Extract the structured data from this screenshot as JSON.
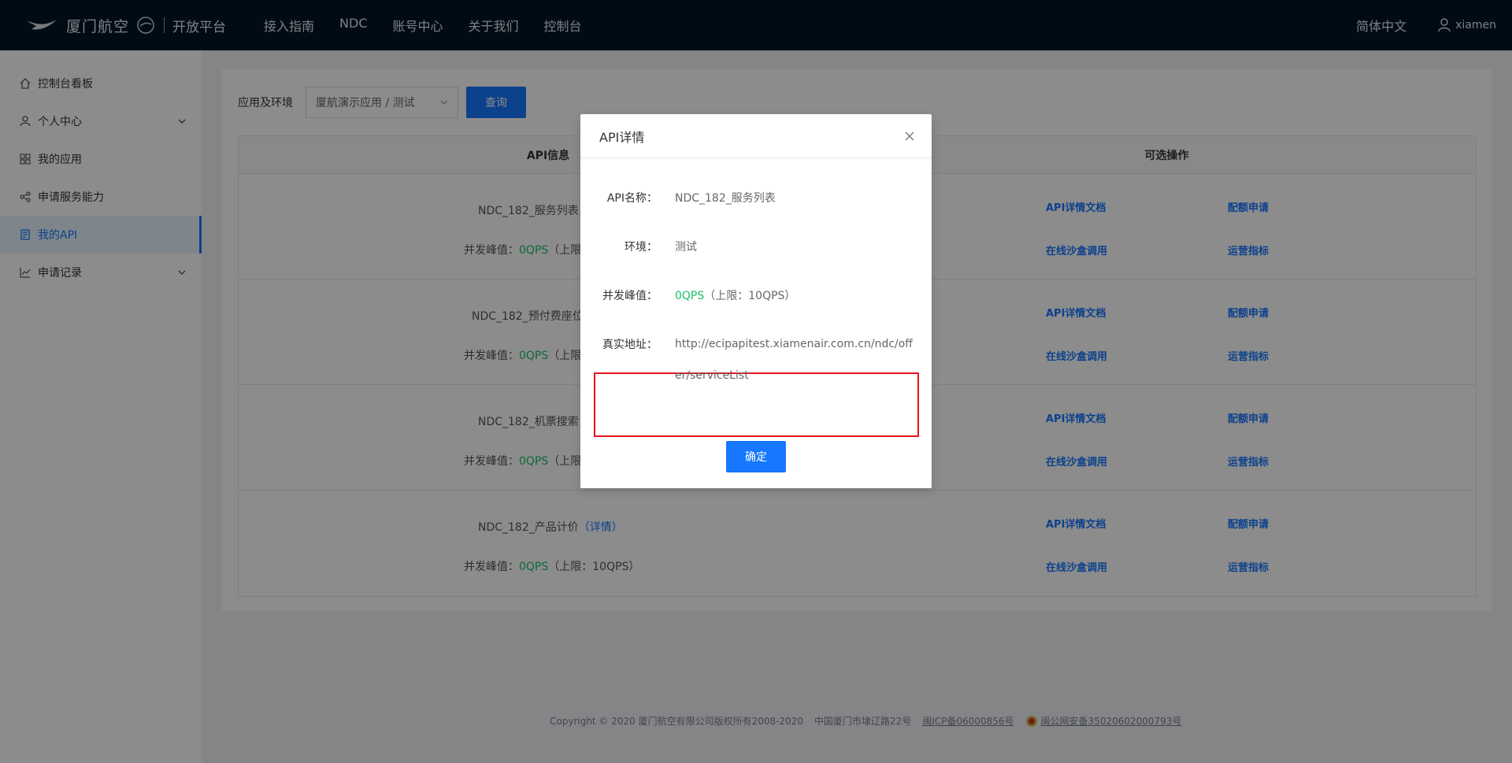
{
  "header": {
    "brand": "厦门航空",
    "subtitle": "开放平台",
    "nav": [
      "接入指南",
      "NDC",
      "账号中心",
      "关于我们",
      "控制台"
    ],
    "language": "简体中文",
    "username": "xiamen"
  },
  "sidebar": {
    "items": [
      {
        "label": "控制台看板",
        "icon": "home-icon"
      },
      {
        "label": "个人中心",
        "icon": "user-icon",
        "expandable": true
      },
      {
        "label": "我的应用",
        "icon": "grid-icon"
      },
      {
        "label": "申请服务能力",
        "icon": "share-icon"
      },
      {
        "label": "我的API",
        "icon": "document-icon",
        "active": true
      },
      {
        "label": "申请记录",
        "icon": "line-chart-icon",
        "expandable": true
      }
    ]
  },
  "filter": {
    "label": "应用及环境",
    "select_value": "厦航演示应用 / 测试",
    "query_button": "查询"
  },
  "table": {
    "headers": [
      "API信息",
      "可选操作"
    ],
    "rows": [
      {
        "name": "NDC_182_服务列表（",
        "peak_label": "并发峰值：",
        "peak_value": "0QPS",
        "peak_limit": "（上限：",
        "ops": [
          "API详情文档",
          "配额申请",
          "在线沙盒调用",
          "运营指标"
        ]
      },
      {
        "name": "NDC_182_预付费座位",
        "peak_label": "并发峰值：",
        "peak_value": "0QPS",
        "peak_limit": "（上限：",
        "ops": [
          "API详情文档",
          "配额申请",
          "在线沙盒调用",
          "运营指标"
        ]
      },
      {
        "name": "NDC_182_机票搜索（",
        "peak_label": "并发峰值：",
        "peak_value": "0QPS",
        "peak_limit": "（上限：",
        "ops": [
          "API详情文档",
          "配额申请",
          "在线沙盒调用",
          "运营指标"
        ]
      },
      {
        "name": "NDC_182_产品计价",
        "detail_link": "（详情）",
        "peak_label": "并发峰值：",
        "peak_value": "0QPS",
        "peak_limit": "（上限：10QPS）",
        "ops": [
          "API详情文档",
          "配额申请",
          "在线沙盒调用",
          "运营指标"
        ]
      }
    ]
  },
  "footer": {
    "copyright": "Copyright © 2020 厦门航空有限公司版权所有2008-2020",
    "address": "中国厦门市埭辽路22号",
    "icp": "闽ICP备06000856号",
    "police": "闽公网安备35020602000793号"
  },
  "modal": {
    "title": "API详情",
    "fields": {
      "name_label": "API名称：",
      "name_value": "NDC_182_服务列表",
      "env_label": "环境：",
      "env_value": "测试",
      "peak_label": "并发峰值：",
      "peak_value": "0QPS",
      "peak_limit": "（上限：10QPS）",
      "url_label": "真实地址：",
      "url_value": "http://ecipapitest.xiamenair.com.cn/ndc/offer/serviceList"
    },
    "ok_button": "确定"
  },
  "colors": {
    "header_bg": "#001529",
    "primary": "#1677ff",
    "green": "#19be6b",
    "highlight_red": "#e8141b"
  }
}
